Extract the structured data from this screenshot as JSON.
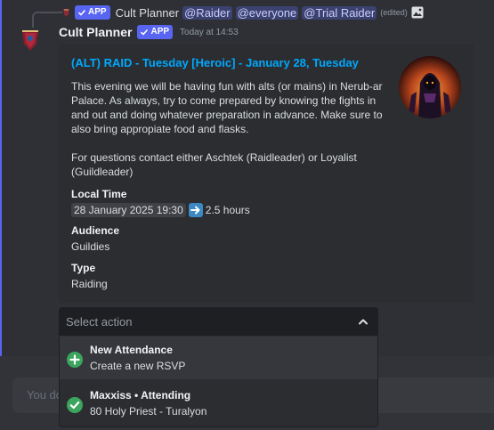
{
  "reply": {
    "app_badge": "APP",
    "author": "Cult Planner",
    "mentions": [
      "@Raider",
      "@everyone",
      "@Trial Raider"
    ],
    "edited": "(edited)"
  },
  "message": {
    "author": "Cult Planner",
    "app_badge": "APP",
    "timestamp": "Today at 14:53"
  },
  "embed": {
    "title": "(ALT) RAID - Tuesday [Heroic] - January 28, Tuesday",
    "description": [
      "This evening we will be having fun with alts (or mains) in Nerub-ar Palace. As always, try to come prepared by knowing the fights in and out and doing whatever preparation in advance. Make sure to also bring appropiate food and flasks.",
      "For questions contact either Aschtek (Raidleader) or Loyalist (Guildleader)"
    ],
    "fields": {
      "local_time": {
        "name": "Local Time",
        "timestamp": "28 January 2025 19:30",
        "duration": "2.5 hours"
      },
      "audience": {
        "name": "Audience",
        "value": "Guildies"
      },
      "type": {
        "name": "Type",
        "value": "Raiding"
      }
    },
    "link_color": "#00a8fc"
  },
  "select": {
    "placeholder": "Select action",
    "options": [
      {
        "title": "New Attendance",
        "description": "Create a new RSVP",
        "icon": "plus-circle-icon",
        "color": "#3ba55d"
      },
      {
        "title": "Maxxiss • Attending",
        "description": "80 Holy Priest - Turalyon",
        "icon": "check-circle-icon",
        "color": "#3ba55d"
      }
    ]
  },
  "composer": {
    "placeholder": "You do"
  }
}
